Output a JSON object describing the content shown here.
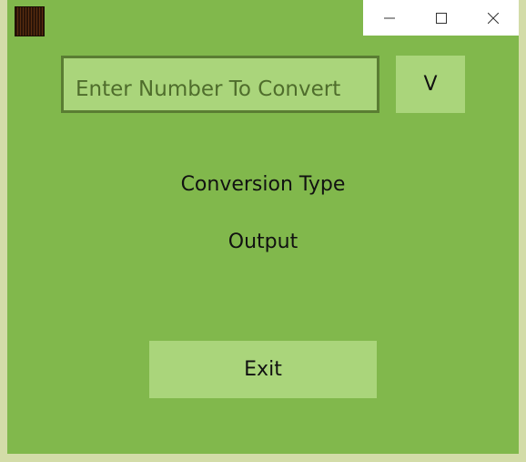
{
  "window": {
    "icon": "app-icon"
  },
  "caption_buttons": {
    "minimize_icon": "minimize-icon",
    "maximize_icon": "maximize-icon",
    "close_icon": "close-icon"
  },
  "input": {
    "value": "",
    "placeholder": "Enter Number To Convert"
  },
  "convert_button": {
    "label": "V"
  },
  "labels": {
    "conversion_type": "Conversion Type",
    "output": "Output"
  },
  "exit_button": {
    "label": "Exit"
  },
  "colors": {
    "window_background": "#81b84c",
    "control_background": "#aad57b",
    "input_border": "#5a7d33",
    "outer_frame": "#d3dca8"
  }
}
